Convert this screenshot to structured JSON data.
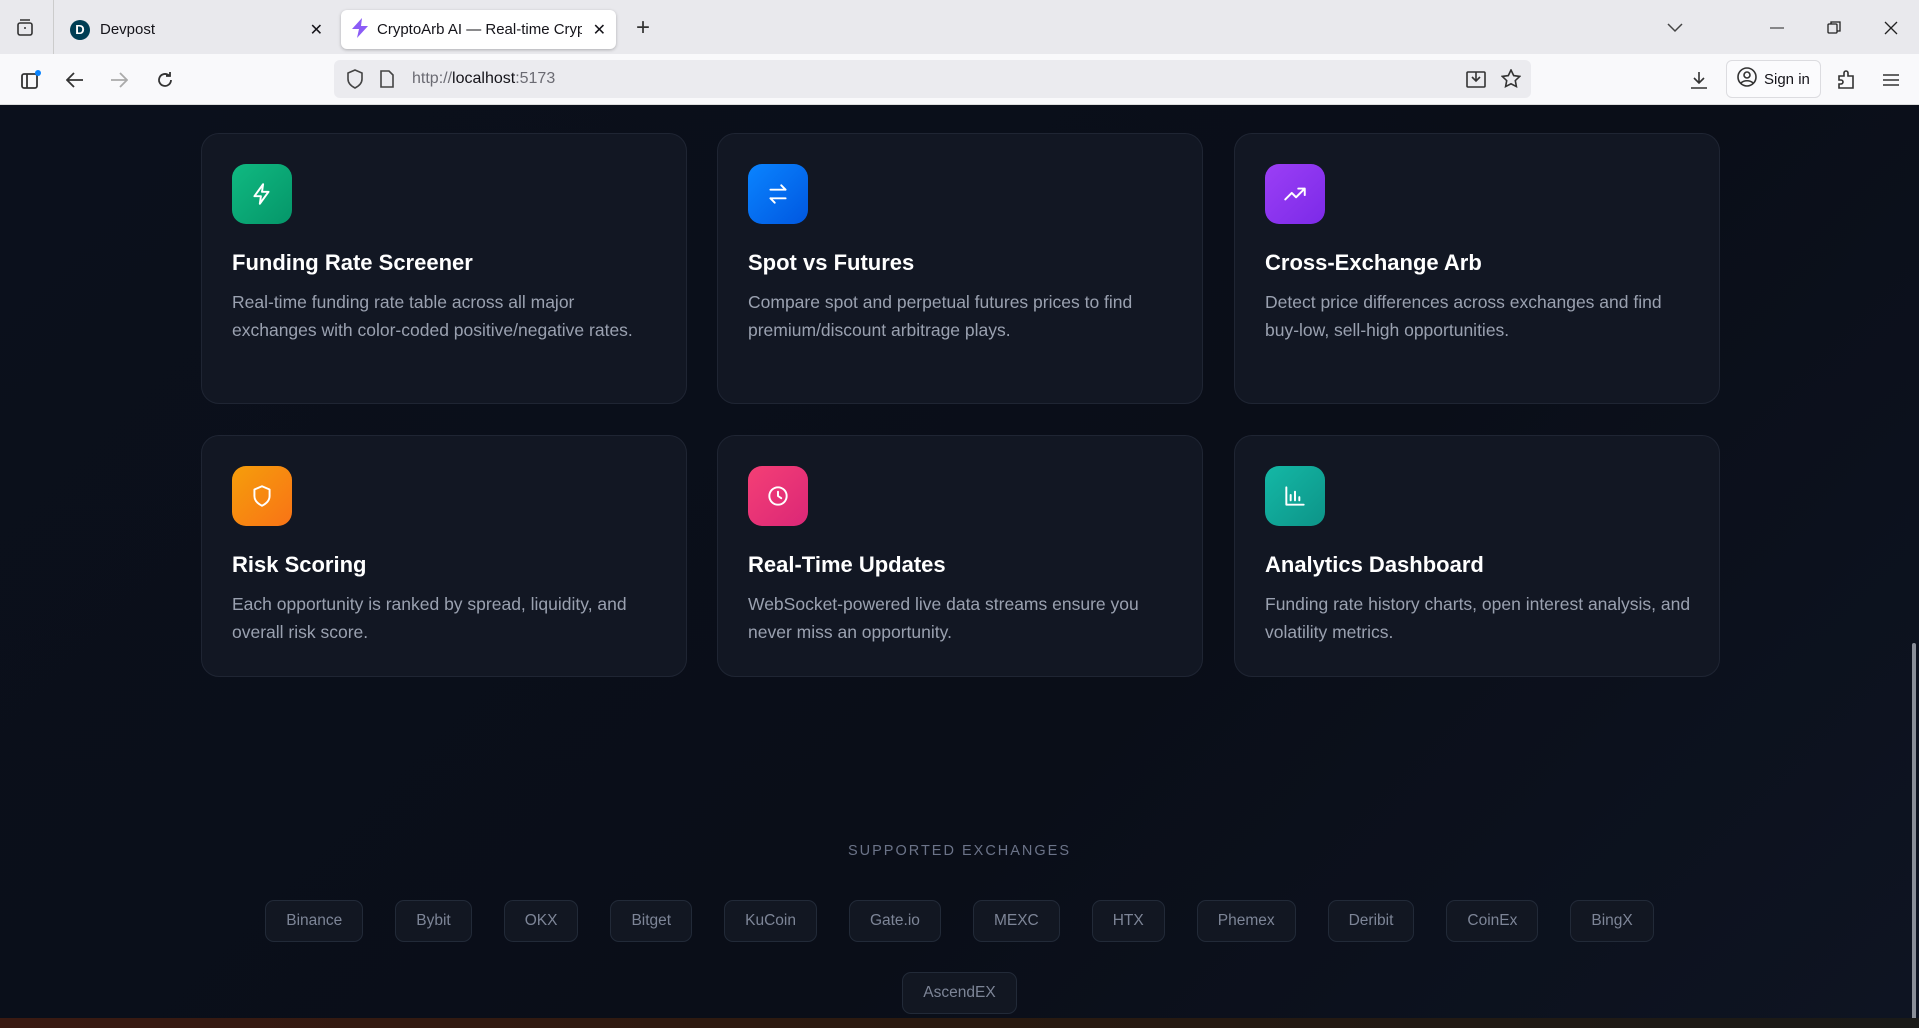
{
  "browser": {
    "tabs": [
      {
        "title": "Devpost",
        "icon": "devpost-logo-icon"
      },
      {
        "title": "CryptoArb AI — Real-time Crypt",
        "icon": "lightning-icon"
      }
    ],
    "url_prefix": "http://",
    "url_host": "localhost",
    "url_port": ":5173",
    "sign_in": "Sign in"
  },
  "features": [
    {
      "title": "Funding Rate Screener",
      "desc": "Real-time funding rate table across all major exchanges with color-coded positive/negative rates.",
      "icon": "lightning-icon",
      "color": "#10b981"
    },
    {
      "title": "Spot vs Futures",
      "desc": "Compare spot and perpetual futures prices to find premium/discount arbitrage plays.",
      "icon": "arrows-swap-icon",
      "color": "#0a84ff"
    },
    {
      "title": "Cross-Exchange Arb",
      "desc": "Detect price differences across exchanges and find buy-low, sell-high opportunities.",
      "icon": "trending-up-icon",
      "color": "#9b3ff5"
    },
    {
      "title": "Risk Scoring",
      "desc": "Each opportunity is ranked by spread, liquidity, and overall risk score.",
      "icon": "shield-icon",
      "color": "#f59e0b"
    },
    {
      "title": "Real-Time Updates",
      "desc": "WebSocket-powered live data streams ensure you never miss an opportunity.",
      "icon": "clock-icon",
      "color": "#f43f75"
    },
    {
      "title": "Analytics Dashboard",
      "desc": "Funding rate history charts, open interest analysis, and volatility metrics.",
      "icon": "bar-chart-icon",
      "color": "#14b8a6"
    }
  ],
  "exchanges_label": "SUPPORTED EXCHANGES",
  "exchanges": [
    "Binance",
    "Bybit",
    "OKX",
    "Bitget",
    "KuCoin",
    "Gate.io",
    "MEXC",
    "HTX",
    "Phemex",
    "Deribit",
    "CoinEx",
    "BingX",
    "AscendEX"
  ]
}
